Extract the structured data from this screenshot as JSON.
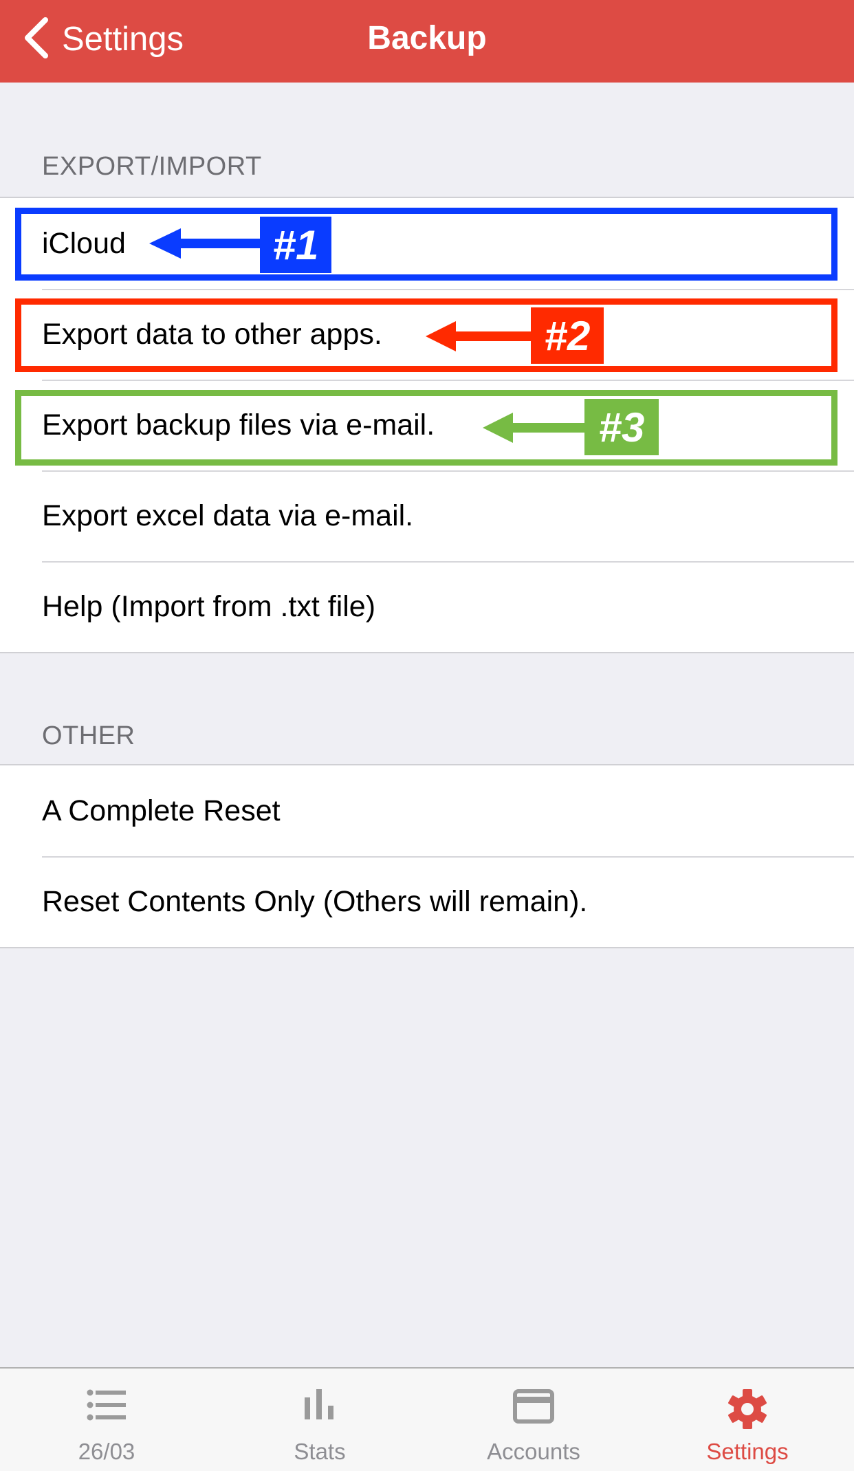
{
  "nav": {
    "back_label": "Settings",
    "title": "Backup",
    "back_icon": "chevron-left-icon",
    "color": "#dd4b44"
  },
  "sections": [
    {
      "header": "EXPORT/IMPORT",
      "items": [
        {
          "label": "iCloud"
        },
        {
          "label": "Export data to other apps."
        },
        {
          "label": "Export backup files via e-mail."
        },
        {
          "label": "Export excel data via e-mail."
        },
        {
          "label": "Help (Import from .txt file)"
        }
      ]
    },
    {
      "header": "OTHER",
      "items": [
        {
          "label": "A Complete Reset"
        },
        {
          "label": "Reset Contents Only (Others will remain)."
        }
      ]
    }
  ],
  "annotations": [
    {
      "tag": "#1",
      "target": "iCloud",
      "color": "#0a3cff"
    },
    {
      "tag": "#2",
      "target": "Export data to other apps.",
      "color": "#ff2a00"
    },
    {
      "tag": "#3",
      "target": "Export backup files via e-mail.",
      "color": "#77bb44"
    }
  ],
  "tabbar": {
    "active": "Settings",
    "tabs": [
      {
        "label": "26/03",
        "icon": "list-icon"
      },
      {
        "label": "Stats",
        "icon": "bar-chart-icon"
      },
      {
        "label": "Accounts",
        "icon": "credit-card-icon"
      },
      {
        "label": "Settings",
        "icon": "gear-icon"
      }
    ],
    "active_color": "#dd4b44",
    "inactive_color": "#8e8e93"
  }
}
